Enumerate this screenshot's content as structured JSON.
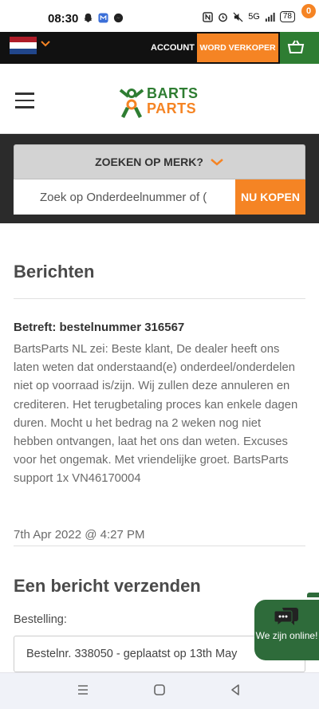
{
  "status_bar": {
    "time": "08:30",
    "battery": "78",
    "network": "5G"
  },
  "topbar": {
    "account_label": "ACCOUNT",
    "seller_label": "WORD VERKOPER",
    "cart_count": "0",
    "flag_colors": [
      "#ae1c28",
      "#ffffff",
      "#21468b"
    ]
  },
  "header": {
    "logo_line1": "BARTS",
    "logo_line2": "PARTS"
  },
  "search": {
    "brand_search_label": "ZOEKEN OP MERK?",
    "part_number_value": "Zoek op Onderdeelnummer of (",
    "buy_button_label": "NU KOPEN"
  },
  "messages": {
    "page_title": "Berichten",
    "items": [
      {
        "subject": "Betreft: bestelnummer 316567",
        "body": "BartsParts NL zei: Beste klant, De dealer heeft ons laten weten dat onderstaand(e) onderdeel/onderdelen niet op voorraad is/zijn. Wij zullen deze annuleren en crediteren. Het terugbetaling proces kan enkele dagen duren. Mocht u het bedrag na 2 weken nog niet hebben ontvangen, laat het ons dan weten. Excuses voor het ongemak. Met vriendelijke groet. BartsParts support 1x VN46170004",
        "date": "7th Apr 2022 @ 4:27 PM"
      }
    ]
  },
  "send_form": {
    "section_title": "Een bericht verzenden",
    "order_label": "Bestelling:",
    "order_selected": "Bestelnr. 338050 - geplaatst op 13th May"
  },
  "chat_widget": {
    "label": "We zijn online!"
  },
  "colors": {
    "accent_orange": "#f58424",
    "brand_green": "#2e7d32",
    "chat_green": "#2e6b3a"
  }
}
